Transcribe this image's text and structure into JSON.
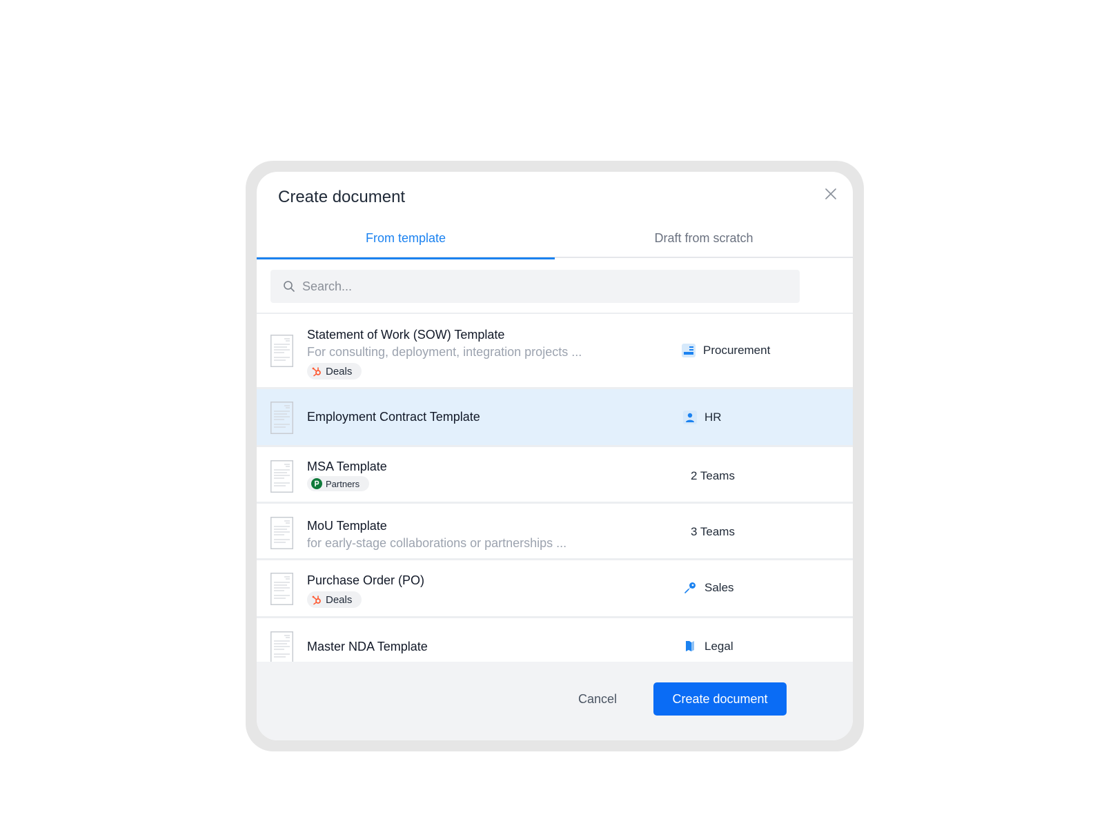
{
  "dialog": {
    "title": "Create document"
  },
  "tabs": [
    {
      "label": "From template",
      "active": true
    },
    {
      "label": "Draft from scratch",
      "active": false
    }
  ],
  "search": {
    "placeholder": "Search...",
    "value": ""
  },
  "templates": [
    {
      "name": "Statement of Work (SOW) Template",
      "description": "For consulting, deployment, integration projects ...",
      "badge": {
        "label": "Deals",
        "icon": "hubspot-icon"
      },
      "team": {
        "label": "Procurement",
        "icon": "procurement-icon"
      },
      "selected": false
    },
    {
      "name": "Employment Contract Template",
      "team": {
        "label": "HR",
        "icon": "person-icon"
      },
      "selected": true
    },
    {
      "name": "MSA Template",
      "badge": {
        "label": "Partners",
        "icon": "partners-icon"
      },
      "team": {
        "label": "2 Teams"
      },
      "selected": false
    },
    {
      "name": "MoU Template",
      "description": "for early-stage collaborations or partnerships ...",
      "team": {
        "label": "3 Teams"
      },
      "selected": false
    },
    {
      "name": "Purchase Order (PO)",
      "badge": {
        "label": "Deals",
        "icon": "hubspot-icon"
      },
      "team": {
        "label": "Sales",
        "icon": "rocket-icon"
      },
      "selected": false
    },
    {
      "name": "Master NDA Template",
      "team": {
        "label": "Legal",
        "icon": "book-icon"
      },
      "selected": false
    }
  ],
  "footer": {
    "cancel_label": "Cancel",
    "create_label": "Create document"
  },
  "colors": {
    "accent": "#1b82f0",
    "primary_button": "#0a6cf5",
    "selected_row": "#e3f0fc",
    "hubspot": "#ff5c35",
    "partners": "#0f7a3a"
  }
}
